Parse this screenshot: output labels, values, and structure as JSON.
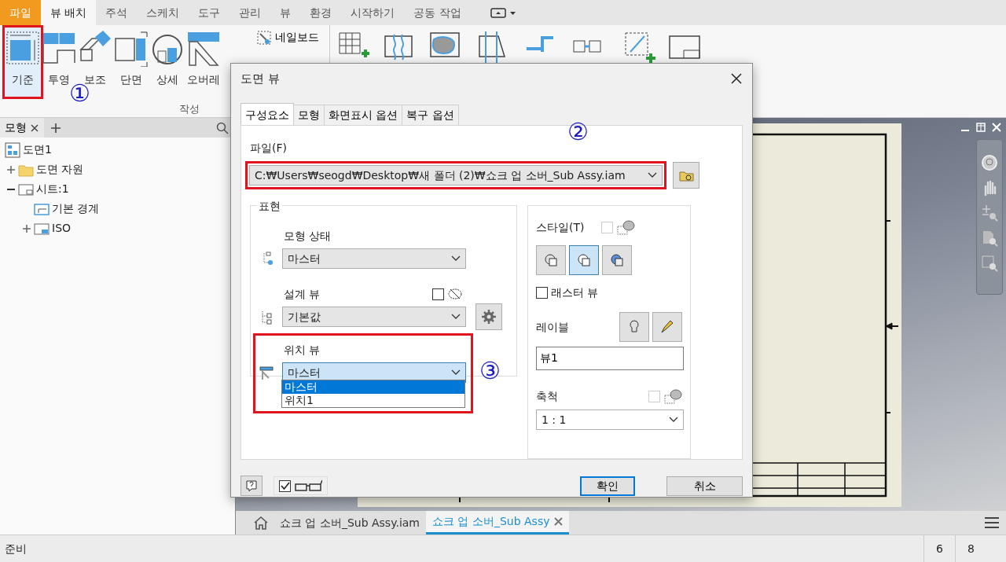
{
  "ribbon": {
    "tabs": [
      {
        "label": "파일",
        "kind": "file",
        "selected": false
      },
      {
        "label": "뷰 배치",
        "kind": "tab",
        "selected": true
      },
      {
        "label": "주석",
        "kind": "tab",
        "selected": false
      },
      {
        "label": "스케치",
        "kind": "tab",
        "selected": false
      },
      {
        "label": "도구",
        "kind": "tab",
        "selected": false
      },
      {
        "label": "관리",
        "kind": "tab",
        "selected": false
      },
      {
        "label": "뷰",
        "kind": "tab",
        "selected": false
      },
      {
        "label": "환경",
        "kind": "tab",
        "selected": false
      },
      {
        "label": "시작하기",
        "kind": "tab",
        "selected": false
      },
      {
        "label": "공동 작업",
        "kind": "tab",
        "selected": false
      }
    ],
    "tools": [
      {
        "label": "기준",
        "kind": "base",
        "selected": true
      },
      {
        "label": "투영",
        "kind": "projected",
        "selected": false
      },
      {
        "label": "보조",
        "kind": "auxiliary",
        "selected": false
      },
      {
        "label": "단면",
        "kind": "section",
        "selected": false
      },
      {
        "label": "상세",
        "kind": "detail",
        "selected": false
      },
      {
        "label": "오버레",
        "kind": "overlay",
        "selected": false
      }
    ],
    "small_tools": [
      {
        "label": "네일보드"
      }
    ],
    "group_label": "작성"
  },
  "markers": [
    "①",
    "②",
    "③"
  ],
  "browser": {
    "tab": "모형",
    "tree": [
      {
        "label": "도면1",
        "kind": "drawing",
        "children": [
          {
            "label": "도면 자원",
            "kind": "folder",
            "expanded": false
          },
          {
            "label": "시트:1",
            "kind": "sheet",
            "expanded": true,
            "children": [
              {
                "label": "기본 경계",
                "kind": "border"
              },
              {
                "label": "ISO",
                "kind": "format",
                "expanded": false
              }
            ]
          }
        ]
      }
    ]
  },
  "dialog": {
    "title": "도면 뷰",
    "tabs": [
      {
        "label": "구성요소",
        "selected": true
      },
      {
        "label": "모형",
        "selected": false
      },
      {
        "label": "화면표시 옵션",
        "selected": false
      },
      {
        "label": "복구 옵션",
        "selected": false
      }
    ],
    "file": {
      "label": "파일(F)",
      "value": "C:₩Users₩seogd₩Desktop₩새 폴더 (2)₩쇼크 업 소버_Sub Assy.iam"
    },
    "representation": {
      "legend": "표현",
      "model_state": {
        "label": "모형 상태",
        "value": "마스터"
      },
      "design_view": {
        "label": "설계 뷰",
        "value": "기본값",
        "checked": false
      },
      "position_view": {
        "label": "위치 뷰",
        "value": "마스터",
        "options": [
          {
            "label": "마스터",
            "selected": true
          },
          {
            "label": "위치1",
            "selected": false
          }
        ]
      }
    },
    "style": {
      "label": "스타일(T)",
      "checked": false,
      "disabled": true,
      "buttons": [
        {
          "kind": "hidden",
          "selected": false
        },
        {
          "kind": "removed",
          "selected": true
        },
        {
          "kind": "shaded",
          "selected": false
        }
      ]
    },
    "raster_view": {
      "label": "래스터 뷰",
      "checked": false
    },
    "view_label": {
      "label": "레이블",
      "value": "뷰1"
    },
    "scale": {
      "label": "축척",
      "value": "1 : 1",
      "checked": false,
      "disabled": true
    },
    "preview": {
      "checked": true
    },
    "buttons": [
      {
        "label": "확인",
        "default": true
      },
      {
        "label": "취소",
        "default": false
      }
    ]
  },
  "document_tabs": [
    {
      "label": "쇼크 업 소버_Sub Assy.iam",
      "selected": false
    },
    {
      "label": "쇼크 업 소버_Sub Assy",
      "selected": true
    }
  ],
  "status_bar": {
    "text": "준비",
    "fields": [
      "6",
      "8"
    ]
  }
}
